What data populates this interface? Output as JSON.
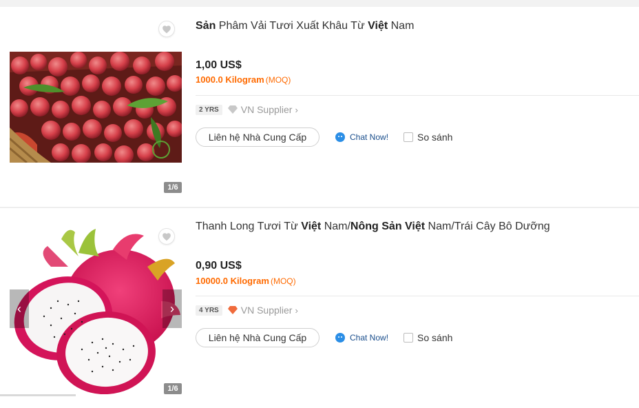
{
  "products": [
    {
      "title_parts": [
        {
          "text": "Sản",
          "bold": true
        },
        {
          "text": " Phâm Vải Tươi Xuất Khâu Từ ",
          "bold": false
        },
        {
          "text": "Việt",
          "bold": true
        },
        {
          "text": " Nam",
          "bold": false
        }
      ],
      "price": "1,00 US$",
      "moq_qty": "1000.0 Kilogram",
      "moq_tag": "(MOQ)",
      "years": "2 YRS",
      "supplier": "VN Supplier",
      "diamond_color": "#c8c8c8",
      "contact_label": "Liên hệ Nhà Cung Cấp",
      "chat_label": "Chat Now!",
      "compare_label": "So sánh",
      "image_counter": "1/6",
      "image_subject": "lychee-fruit"
    },
    {
      "title_parts": [
        {
          "text": "Thanh Long Tươi Từ ",
          "bold": false
        },
        {
          "text": "Việt",
          "bold": true
        },
        {
          "text": " Nam/",
          "bold": false
        },
        {
          "text": "Nông Sản Việt",
          "bold": true
        },
        {
          "text": " Nam/Trái Cây Bô Dưỡng",
          "bold": false
        }
      ],
      "price": "0,90 US$",
      "moq_qty": "10000.0 Kilogram",
      "moq_tag": "(MOQ)",
      "years": "4 YRS",
      "supplier": "VN Supplier",
      "diamond_color": "#f06b3c",
      "contact_label": "Liên hệ Nhà Cung Cấp",
      "chat_label": "Chat Now!",
      "compare_label": "So sánh",
      "image_counter": "1/6",
      "image_subject": "dragon-fruit"
    }
  ],
  "colors": {
    "moq": "#ff6a00",
    "chat": "#1a4e8c",
    "chat_icon": "#2b8ee6"
  }
}
